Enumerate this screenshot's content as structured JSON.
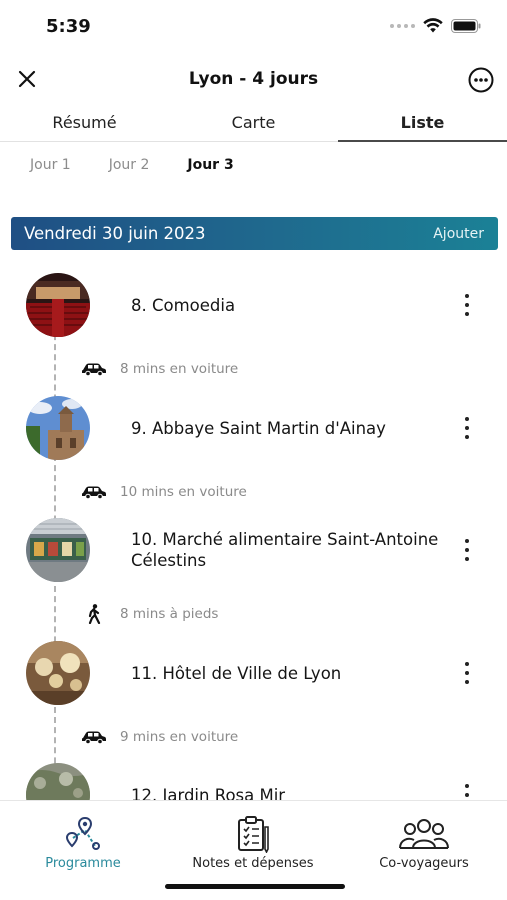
{
  "status_bar": {
    "time": "5:39"
  },
  "header": {
    "title": "Lyon - 4 jours"
  },
  "tabs": [
    {
      "label": "Résumé",
      "active": false
    },
    {
      "label": "Carte",
      "active": false
    },
    {
      "label": "Liste",
      "active": true
    }
  ],
  "day_tabs": [
    {
      "label": "Jour 1",
      "active": false
    },
    {
      "label": "Jour 2",
      "active": false
    },
    {
      "label": "Jour 3",
      "active": true
    }
  ],
  "date_banner": {
    "date": "Vendredi 30 juin 2023",
    "add_label": "Ajouter"
  },
  "places": [
    {
      "name": "8. Comoedia",
      "thumb": "theater-interior"
    },
    {
      "name": "9. Abbaye Saint Martin d'Ainay",
      "thumb": "abbey-church"
    },
    {
      "name": "10. Marché alimentaire Saint-Antoine Célestins",
      "thumb": "market-stall"
    },
    {
      "name": "11. Hôtel de Ville de Lyon",
      "thumb": "chandelier-hall"
    },
    {
      "name": "12. Jardin Rosa Mir",
      "thumb": "garden"
    }
  ],
  "transits": [
    {
      "text": "8 mins en voiture",
      "icon": "car-icon"
    },
    {
      "text": "10 mins en voiture",
      "icon": "car-icon"
    },
    {
      "text": "8 mins à pieds",
      "icon": "walking-icon"
    },
    {
      "text": "9 mins en voiture",
      "icon": "car-icon"
    }
  ],
  "bottom_nav": [
    {
      "label": "Programme",
      "icon": "route-icon",
      "active": true
    },
    {
      "label": "Notes et dépenses",
      "icon": "clipboard-icon",
      "active": false
    },
    {
      "label": "Co-voyageurs",
      "icon": "group-icon",
      "active": false
    }
  ],
  "colors": {
    "accent": "#2a8a9c",
    "banner_start": "#1f4f84",
    "banner_end": "#1b8196"
  }
}
